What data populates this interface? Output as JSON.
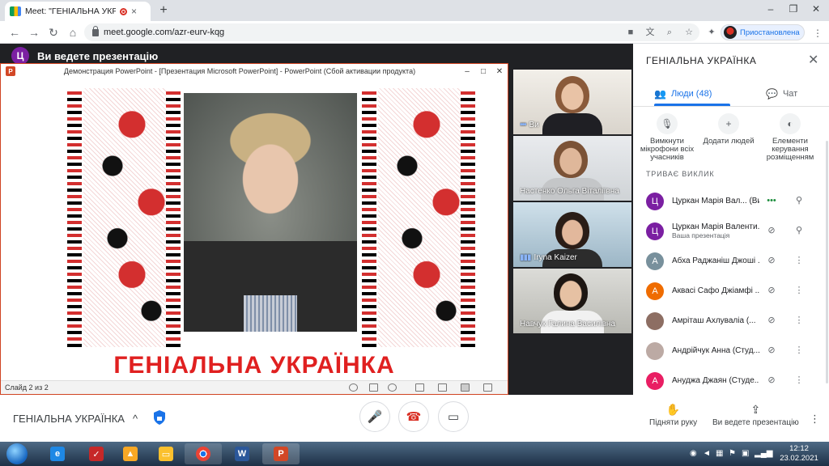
{
  "browser": {
    "tab_title": "Meet: \"ГЕНІАЛЬНА УКРАЇНКА",
    "tab_close": "×",
    "newtab": "+",
    "url": "meet.google.com/azr-eurv-kqg",
    "profile_label": "Приостановлена",
    "win_min": "–",
    "win_max": "❐",
    "win_close": "✕"
  },
  "presenting_banner": {
    "avatar": "Ц",
    "text": "Ви ведете презентацію"
  },
  "powerpoint": {
    "window_title": "Демонстрация PowerPoint - [Презентация Microsoft PowerPoint] - PowerPoint (Сбой активации продукта)",
    "logo": "P",
    "slide_title": "ГЕНІАЛЬНА УКРАЇНКА",
    "slide_counter": "Слайд 2 из 2"
  },
  "tiles": [
    {
      "name": "Ви",
      "indicator": "•••"
    },
    {
      "name": "Настенко Ольга Віталіївна",
      "indicator": ""
    },
    {
      "name": "Iryna Kaizer",
      "indicator": "▮▮▮"
    },
    {
      "name": "Навчук Галина Василівна",
      "indicator": ""
    }
  ],
  "panel": {
    "title": "ГЕНІАЛЬНА УКРАЇНКА",
    "close": "✕",
    "tab_people": "Люди (48)",
    "tab_chat": "Чат",
    "actions": [
      {
        "label": "Вимкнути мікрофони всіх учасників",
        "icon": "mic-off-icon"
      },
      {
        "label": "Додати людей",
        "icon": "add-person-icon"
      },
      {
        "label": "Елементи керування розміщенням",
        "icon": "toggle-icon"
      }
    ],
    "section_label": "ТРИВАЄ ВИКЛИК",
    "participants": [
      {
        "avatar": "Ц",
        "color": "#7b1fa2",
        "name": "Цуркан Марія Вал... (Ви)",
        "sub": ""
      },
      {
        "avatar": "Ц",
        "color": "#7b1fa2",
        "name": "Цуркан Марія Валенти...",
        "sub": "Ваша презентація"
      },
      {
        "avatar": "А",
        "color": "#78909c",
        "name": "Абха Раджаніш Джоші ...",
        "sub": ""
      },
      {
        "avatar": "А",
        "color": "#ef6c00",
        "name": "Аквасі Сафо Джіамфі ...",
        "sub": ""
      },
      {
        "avatar": "",
        "color": "#8d6e63",
        "name": "Амріташ Ахлуваліа (...",
        "sub": ""
      },
      {
        "avatar": "",
        "color": "#bcaaa4",
        "name": "Андрійчук Анна (Студ...",
        "sub": ""
      },
      {
        "avatar": "А",
        "color": "#e91e63",
        "name": "Ануджа Джаян (Студе...",
        "sub": ""
      }
    ]
  },
  "bottom": {
    "meeting_name": "ГЕНІАЛЬНА УКРАЇНКА",
    "chevron": "^",
    "raise_hand": "Підняти руку",
    "presenting": "Ви ведете презентацію",
    "more": "⋮"
  },
  "taskbar": {
    "time": "12:12",
    "date": "23.02.2021"
  }
}
